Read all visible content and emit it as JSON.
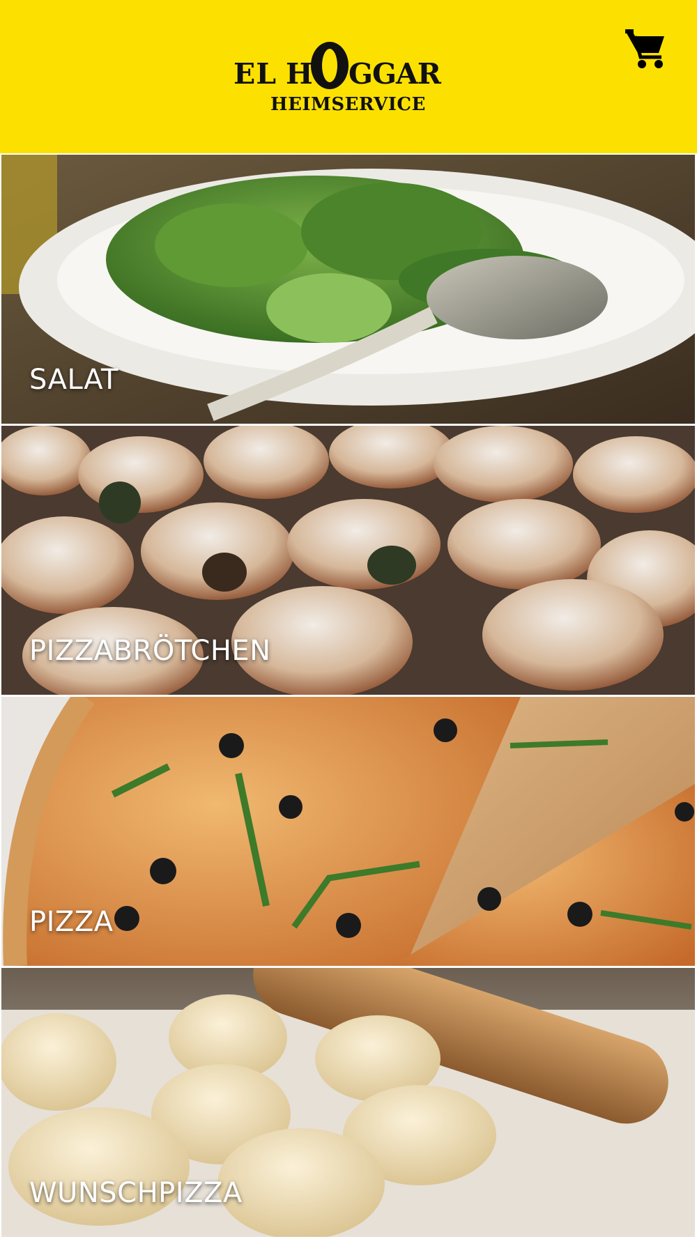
{
  "header": {
    "logo": {
      "el": "EL",
      "h": "H",
      "o": "O",
      "ggar": "GGAR",
      "subtitle": "HEIMSERVICE"
    },
    "cart_icon": "shopping-cart-icon"
  },
  "categories": [
    {
      "label": "SALAT",
      "image": "salad-photo"
    },
    {
      "label": "PIZZABRÖTCHEN",
      "image": "pizza-rolls-photo"
    },
    {
      "label": "PIZZA",
      "image": "pizza-photo"
    },
    {
      "label": "WUNSCHPIZZA",
      "image": "dough-balls-photo"
    }
  ],
  "colors": {
    "header_bg": "#fce100",
    "label_text": "#ffffff"
  }
}
